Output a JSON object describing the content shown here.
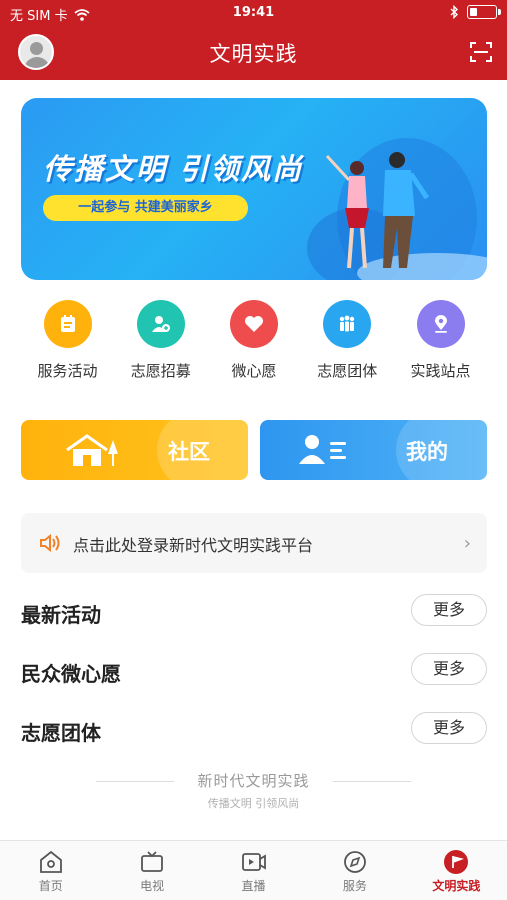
{
  "status_bar": {
    "carrier": "无 SIM 卡",
    "time": "19:41"
  },
  "header": {
    "title": "文明实践"
  },
  "banner": {
    "headline": "传播文明 引领风尚",
    "tagline": "一起参与 共建美丽家乡"
  },
  "quick_links": [
    {
      "label": "服务活动",
      "icon": "calendar-icon",
      "color": "#ffb20c"
    },
    {
      "label": "志愿招募",
      "icon": "user-add-icon",
      "color": "#20c4b0"
    },
    {
      "label": "微心愿",
      "icon": "heart-icon",
      "color": "#ef4d4d"
    },
    {
      "label": "志愿团体",
      "icon": "group-icon",
      "color": "#28a7f0"
    },
    {
      "label": "实践站点",
      "icon": "location-icon",
      "color": "#8b7cf0"
    }
  ],
  "shortcuts": {
    "community": "社区",
    "mine": "我的"
  },
  "notice": {
    "text": "点击此处登录新时代文明实践平台"
  },
  "sections": [
    {
      "title": "最新活动",
      "more": "更多"
    },
    {
      "title": "民众微心愿",
      "more": "更多"
    },
    {
      "title": "志愿团体",
      "more": "更多"
    }
  ],
  "footer": {
    "slogan": "新时代文明实践",
    "sub": "传播文明 引领风尚"
  },
  "tabbar": [
    {
      "label": "首页",
      "icon": "home-icon"
    },
    {
      "label": "电视",
      "icon": "tv-icon"
    },
    {
      "label": "直播",
      "icon": "live-icon"
    },
    {
      "label": "服务",
      "icon": "compass-icon"
    },
    {
      "label": "文明实践",
      "icon": "flag-icon",
      "active": true
    }
  ],
  "colors": {
    "brand_red": "#c71f24",
    "banner_blue": "#2b9af3",
    "community_yellow": "#ffb20c",
    "mine_blue": "#2e96f0"
  }
}
